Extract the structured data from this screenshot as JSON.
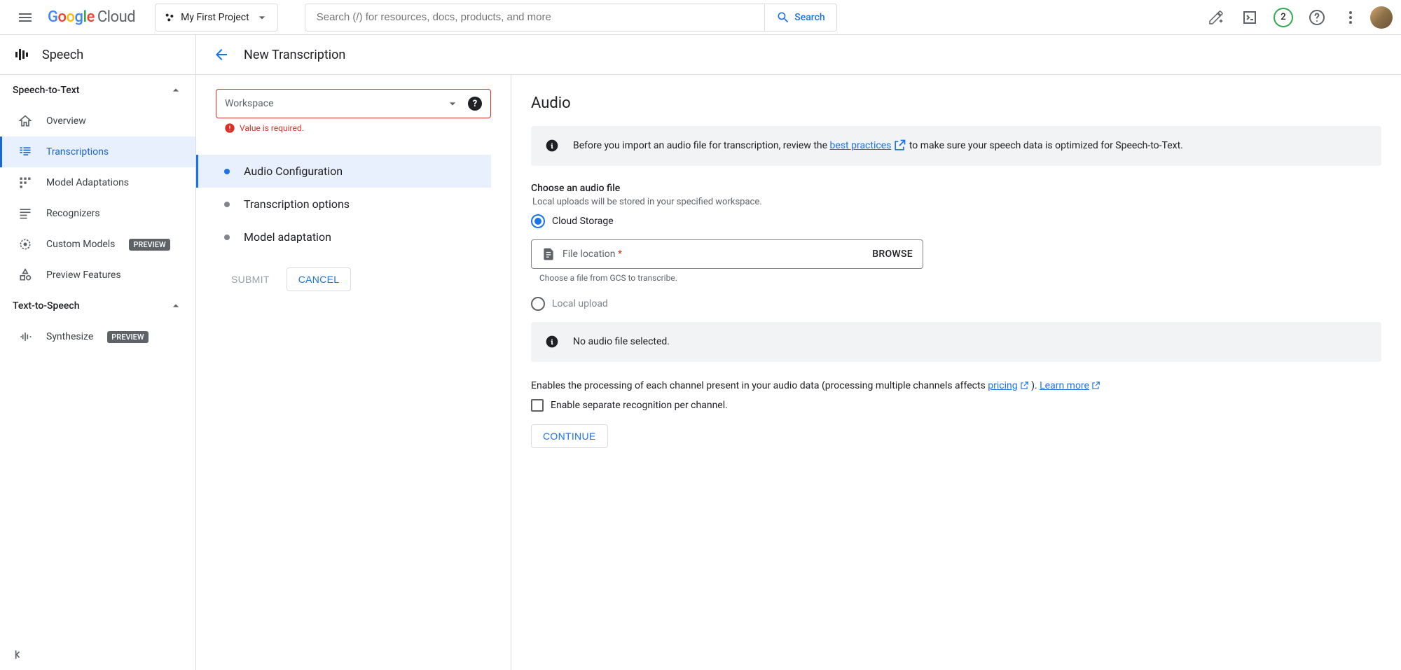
{
  "header": {
    "logo_cloud": "Cloud",
    "project_name": "My First Project",
    "search_placeholder": "Search (/) for resources, docs, products, and more",
    "search_button": "Search",
    "trial_count": "2"
  },
  "sidebar": {
    "product": "Speech",
    "sections": {
      "stt": {
        "title": "Speech-to-Text",
        "items": {
          "overview": "Overview",
          "transcriptions": "Transcriptions",
          "adaptations": "Model Adaptations",
          "recognizers": "Recognizers",
          "custom_models": "Custom Models",
          "preview_features": "Preview Features"
        }
      },
      "tts": {
        "title": "Text-to-Speech",
        "items": {
          "synthesize": "Synthesize"
        }
      }
    },
    "preview_badge": "PREVIEW"
  },
  "content": {
    "title": "New Transcription",
    "workspace": {
      "label": "Workspace",
      "error": "Value is required."
    },
    "stepper": {
      "audio_config": "Audio Configuration",
      "transcription_options": "Transcription options",
      "model_adaptation": "Model adaptation",
      "submit": "SUBMIT",
      "cancel": "CANCEL"
    },
    "form": {
      "section_title": "Audio",
      "info_prefix": "Before you import an audio file for transcription, review the ",
      "info_link": "best practices",
      "info_suffix": " to make sure your speech data is optimized for Speech-to-Text.",
      "choose_label": "Choose an audio file",
      "choose_hint": "Local uploads will be stored in your specified workspace.",
      "radio_cloud": "Cloud Storage",
      "radio_local": "Local upload",
      "file_location": "File location",
      "browse": "BROWSE",
      "file_hint": "Choose a file from GCS to transcribe.",
      "no_file": "No audio file selected.",
      "channel_text_prefix": "Enables the processing of each channel present in your audio data (processing multiple channels affects ",
      "channel_pricing": "pricing",
      "channel_text_mid": " ). ",
      "channel_learn": "Learn more",
      "channel_checkbox": "Enable separate recognition per channel.",
      "continue": "CONTINUE"
    }
  }
}
